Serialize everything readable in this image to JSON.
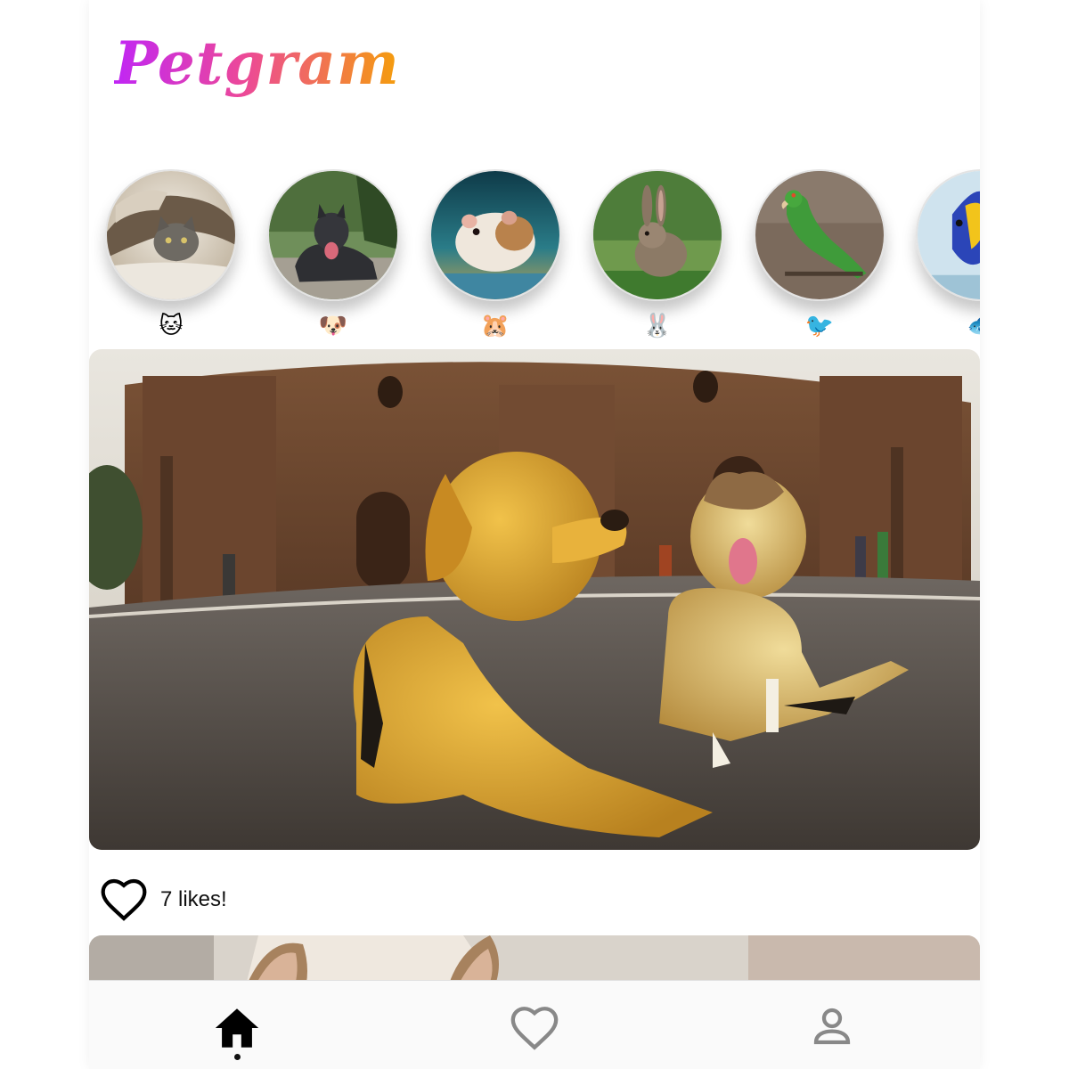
{
  "app": {
    "title": "Petgram",
    "accent_gradient": [
      "#c026f5",
      "#ec4899",
      "#f59e0b"
    ]
  },
  "categories": [
    {
      "emoji": "🐱",
      "name": "cat",
      "photo_icon": "cat-photo"
    },
    {
      "emoji": "🐶",
      "name": "dog",
      "photo_icon": "dog-photo"
    },
    {
      "emoji": "🐹",
      "name": "hamster",
      "photo_icon": "hamster-photo"
    },
    {
      "emoji": "🐰",
      "name": "rabbit",
      "photo_icon": "rabbit-photo"
    },
    {
      "emoji": "🐦",
      "name": "bird",
      "photo_icon": "parrot-photo"
    },
    {
      "emoji": "🐟",
      "name": "fish",
      "photo_icon": "fish-photo"
    }
  ],
  "post": {
    "photo_icon": "two-dogs-in-front-of-cathedral-photo",
    "likes_text": "7 likes!",
    "liked": false
  },
  "nav": {
    "items": [
      {
        "name": "home",
        "icon": "home-icon",
        "active": true
      },
      {
        "name": "favorites",
        "icon": "heart-icon",
        "active": false
      },
      {
        "name": "user",
        "icon": "user-icon",
        "active": false
      }
    ]
  }
}
